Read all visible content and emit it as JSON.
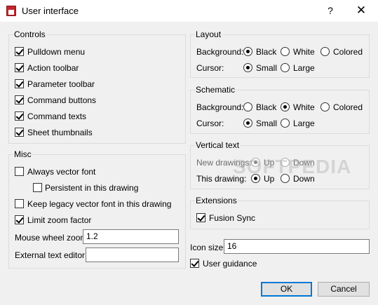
{
  "window": {
    "title": "User interface",
    "help": "?",
    "close": "✕"
  },
  "controls": {
    "title": "Controls",
    "items": [
      {
        "label": "Pulldown menu",
        "checked": true
      },
      {
        "label": "Action toolbar",
        "checked": true
      },
      {
        "label": "Parameter toolbar",
        "checked": true
      },
      {
        "label": "Command buttons",
        "checked": true
      },
      {
        "label": "Command texts",
        "checked": true
      },
      {
        "label": "Sheet thumbnails",
        "checked": true
      }
    ]
  },
  "misc": {
    "title": "Misc",
    "always_vector_font": "Always vector font",
    "persistent": "Persistent in this drawing",
    "keep_legacy": "Keep legacy vector font in this drawing",
    "limit_zoom": "Limit zoom factor",
    "mouse_wheel_label": "Mouse wheel zoom",
    "mouse_wheel_value": "1.2",
    "ext_editor_label": "External text editor",
    "ext_editor_value": ""
  },
  "layout": {
    "title": "Layout",
    "background_label": "Background:",
    "cursor_label": "Cursor:",
    "bg_options": [
      "Black",
      "White",
      "Colored"
    ],
    "bg_selected": "Black",
    "cursor_options": [
      "Small",
      "Large"
    ],
    "cursor_selected": "Small"
  },
  "schematic": {
    "title": "Schematic",
    "background_label": "Background:",
    "cursor_label": "Cursor:",
    "bg_options": [
      "Black",
      "White",
      "Colored"
    ],
    "bg_selected": "White",
    "cursor_options": [
      "Small",
      "Large"
    ],
    "cursor_selected": "Small"
  },
  "vertical_text": {
    "title": "Vertical text",
    "new_drawings_label": "New drawings:",
    "this_drawing_label": "This drawing:",
    "options": [
      "Up",
      "Down"
    ],
    "new_selected": "Up",
    "this_selected": "Up"
  },
  "extensions": {
    "title": "Extensions",
    "fusion_sync": "Fusion Sync"
  },
  "icon_size": {
    "label": "Icon size",
    "value": "16"
  },
  "user_guidance": "User guidance",
  "buttons": {
    "ok": "OK",
    "cancel": "Cancel"
  },
  "watermark": "SOFTPEDIA",
  "colors": {
    "focus": "#0078d7",
    "dialog_bg": "#f0f0f0"
  }
}
